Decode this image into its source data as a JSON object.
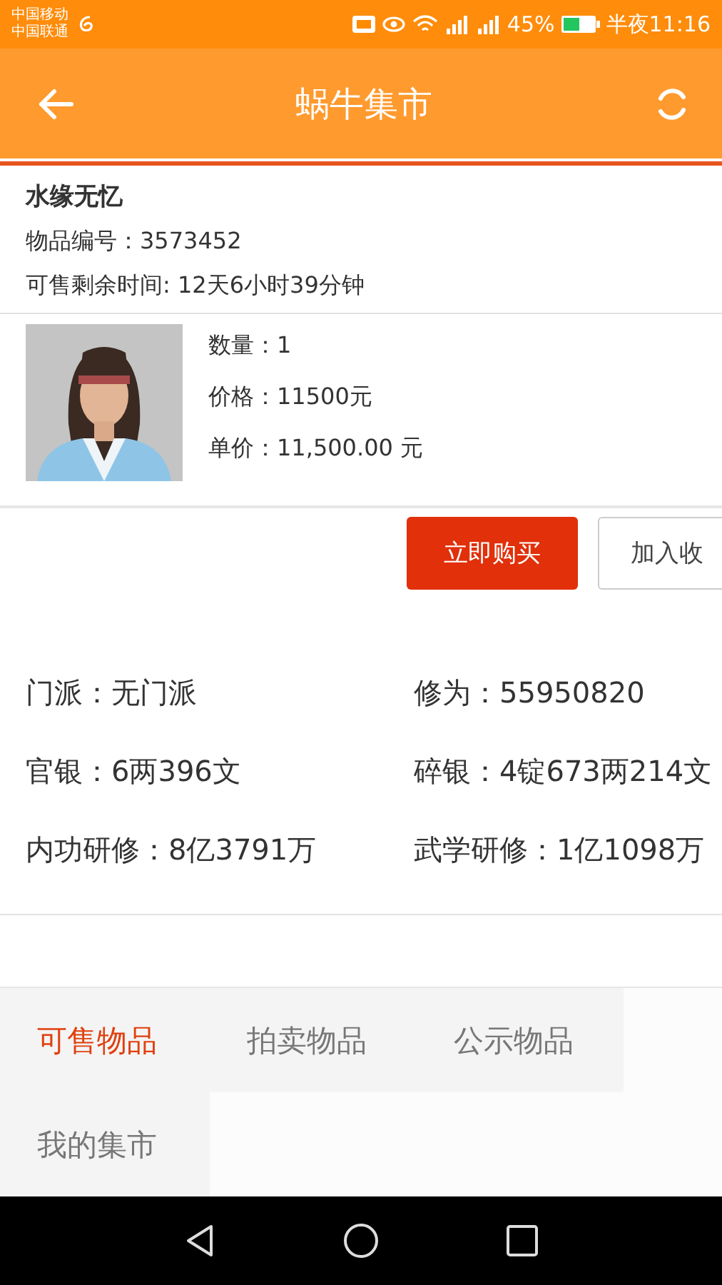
{
  "status_bar": {
    "carriers": [
      "中国移动",
      "中国联通"
    ],
    "battery": "45%",
    "time": "半夜11:16"
  },
  "header": {
    "title": "蜗牛集市"
  },
  "item": {
    "name": "水缘无忆",
    "number": "物品编号：3573452",
    "remaining": "可售剩余时间: 12天6小时39分钟",
    "details": [
      "数量：1",
      "价格：11500元",
      "单价：11,500.00 元"
    ]
  },
  "buttons": [
    {
      "label": "立即购买",
      "kind": "primary"
    },
    {
      "label": "加入收",
      "kind": "secondary"
    }
  ],
  "stats": [
    "门派：无门派",
    "修为：55950820",
    "官银：6两396文",
    "碎银：4锭673两214文",
    "内功研修：8亿3791万",
    "武学研修：1亿1098万"
  ],
  "tabs": [
    {
      "label": "可售物品",
      "selected": true
    },
    {
      "label": "拍卖物品",
      "selected": false
    },
    {
      "label": "公示物品",
      "selected": false
    },
    {
      "label": "我的集市",
      "selected": false
    }
  ]
}
